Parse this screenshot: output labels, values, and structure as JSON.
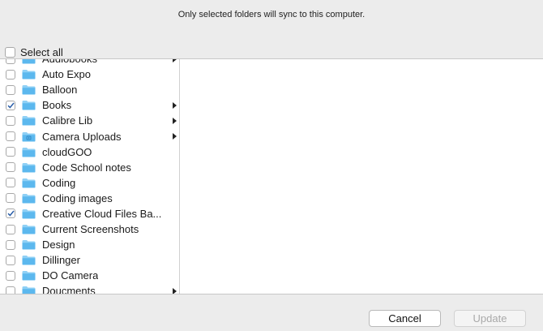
{
  "header": {
    "message": "Only selected folders will sync to this computer."
  },
  "select_all": {
    "label": "Select all",
    "checked": false
  },
  "folders": [
    {
      "label": "Audiobooks",
      "checked": false,
      "has_children": true,
      "icon": "folder-icon"
    },
    {
      "label": "Auto Expo",
      "checked": false,
      "has_children": false,
      "icon": "folder-icon"
    },
    {
      "label": "Balloon",
      "checked": false,
      "has_children": false,
      "icon": "folder-icon"
    },
    {
      "label": "Books",
      "checked": true,
      "has_children": true,
      "icon": "folder-icon"
    },
    {
      "label": "Calibre Lib",
      "checked": false,
      "has_children": true,
      "icon": "folder-icon"
    },
    {
      "label": "Camera Uploads",
      "checked": false,
      "has_children": true,
      "icon": "camera-folder-icon"
    },
    {
      "label": "cloudGOO",
      "checked": false,
      "has_children": false,
      "icon": "folder-icon"
    },
    {
      "label": "Code School notes",
      "checked": false,
      "has_children": false,
      "icon": "folder-icon"
    },
    {
      "label": "Coding",
      "checked": false,
      "has_children": false,
      "icon": "folder-icon"
    },
    {
      "label": "Coding images",
      "checked": false,
      "has_children": false,
      "icon": "folder-icon"
    },
    {
      "label": "Creative Cloud Files Ba...",
      "checked": true,
      "has_children": false,
      "icon": "folder-icon"
    },
    {
      "label": "Current Screenshots",
      "checked": false,
      "has_children": false,
      "icon": "folder-icon"
    },
    {
      "label": "Design",
      "checked": false,
      "has_children": false,
      "icon": "folder-icon"
    },
    {
      "label": "Dillinger",
      "checked": false,
      "has_children": false,
      "icon": "folder-icon"
    },
    {
      "label": "DO Camera",
      "checked": false,
      "has_children": false,
      "icon": "folder-icon"
    },
    {
      "label": "Doucments",
      "checked": false,
      "has_children": true,
      "icon": "folder-icon"
    }
  ],
  "buttons": {
    "cancel": "Cancel",
    "update": "Update",
    "update_enabled": false
  },
  "colors": {
    "folder": "#5cb8ee",
    "folder_tab": "#8fd0f5",
    "checkmark": "#2a5ea8",
    "chevron": "#222222"
  }
}
